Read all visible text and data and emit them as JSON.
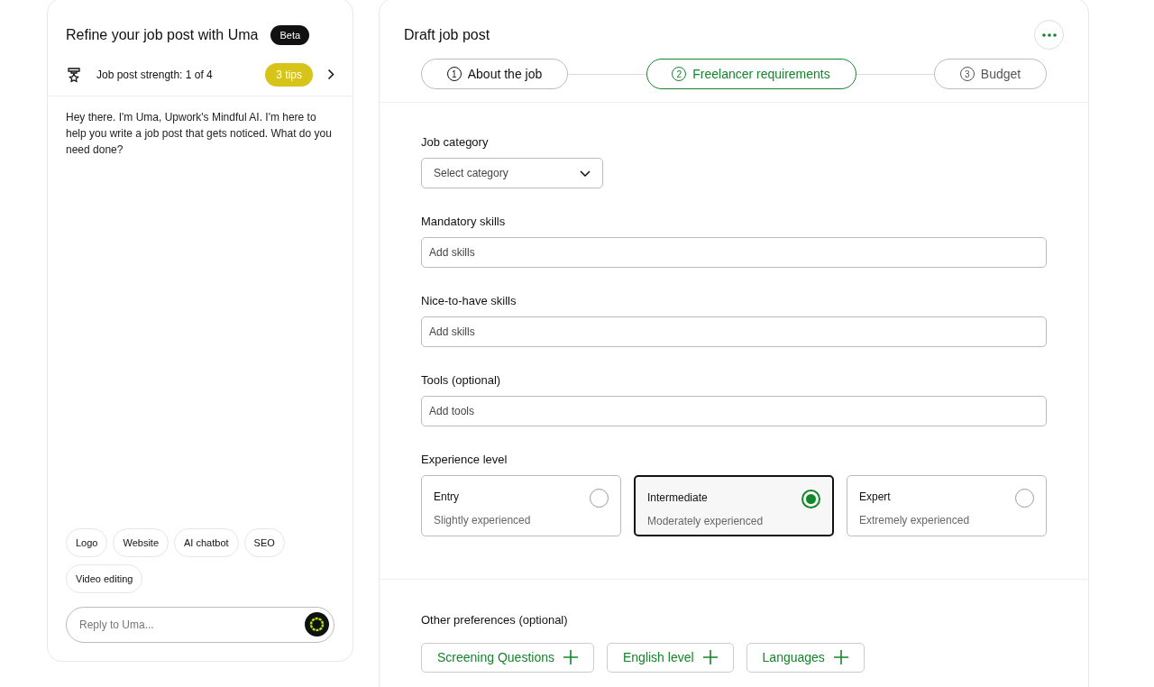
{
  "assistant": {
    "title": "Refine your job post with Uma",
    "badge": "Beta",
    "strength": {
      "label": "Job post strength: 1 of 4",
      "tips": "3 tips"
    },
    "message": "Hey there. I'm Uma, Upwork's Mindful AI. I'm here to help you write a job post that gets noticed. What do you need done?",
    "suggestions": [
      "Logo",
      "Website",
      "AI chatbot",
      "SEO",
      "Video editing"
    ],
    "reply": {
      "placeholder": "Reply to Uma..."
    }
  },
  "draft": {
    "title": "Draft job post",
    "steps": [
      {
        "number": "1",
        "label": "About the job",
        "selected": false,
        "disabled": false
      },
      {
        "number": "2",
        "label": "Freelancer requirements",
        "selected": true,
        "disabled": false
      },
      {
        "number": "3",
        "label": "Budget",
        "selected": false,
        "disabled": true
      }
    ],
    "fields": [
      {
        "kind": "select",
        "label": "Job category",
        "placeholder": "Select category"
      },
      {
        "kind": "text",
        "label": "Mandatory skills",
        "placeholder": "Add skills"
      },
      {
        "kind": "text",
        "label": "Nice-to-have skills",
        "placeholder": "Add skills"
      },
      {
        "kind": "text",
        "label": "Tools (optional)",
        "placeholder": "Add tools"
      }
    ],
    "experience": {
      "label": "Experience level",
      "options": [
        {
          "title": "Entry",
          "subtitle": "Slightly experienced",
          "selected": false
        },
        {
          "title": "Intermediate",
          "subtitle": "Moderately experienced",
          "selected": true
        },
        {
          "title": "Expert",
          "subtitle": "Extremely experienced",
          "selected": false
        }
      ]
    },
    "preferences": {
      "label": "Other preferences (optional)",
      "buttons": [
        "Screening Questions",
        "English level",
        "Languages"
      ]
    }
  }
}
